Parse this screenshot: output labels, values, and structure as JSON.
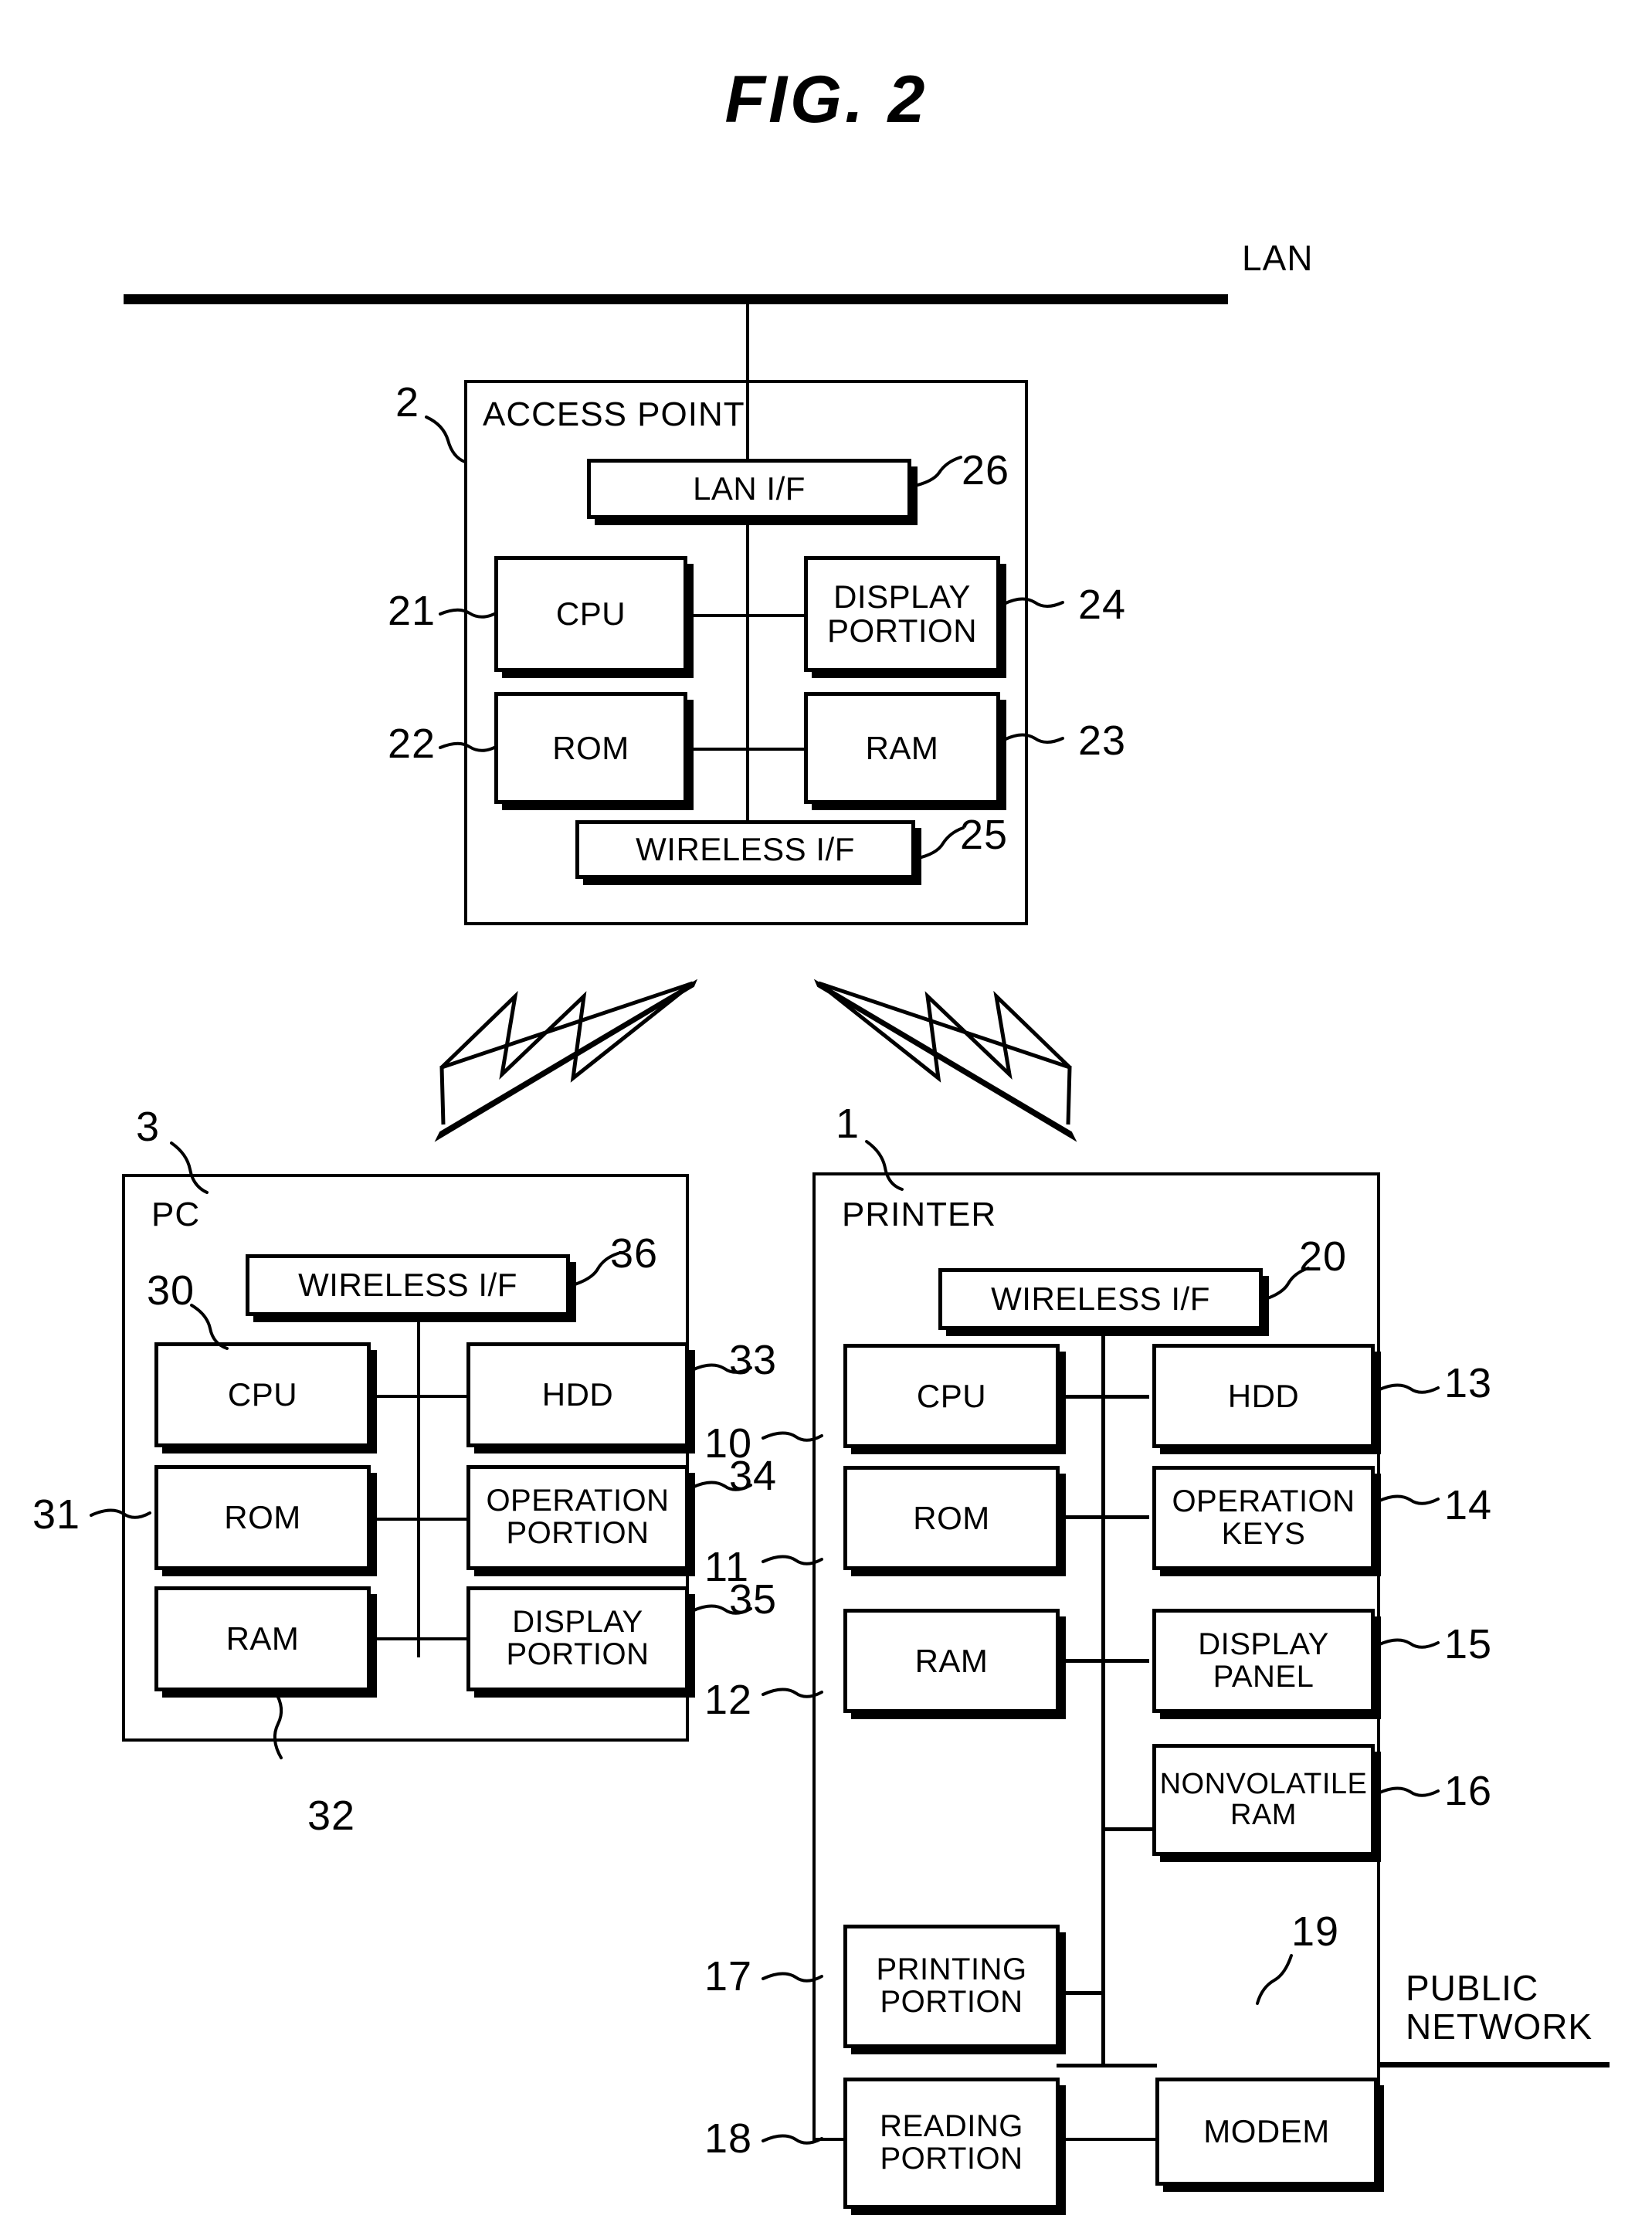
{
  "figure": {
    "title": "FIG.  2"
  },
  "network": {
    "lan_label": "LAN",
    "public_network_label": "PUBLIC\nNETWORK",
    "public_network_line1": "PUBLIC",
    "public_network_line2": "NETWORK"
  },
  "access_point": {
    "title": "ACCESS POINT",
    "ref": "2",
    "blocks": [
      {
        "label": "LAN I/F",
        "ref": "26"
      },
      {
        "label": "CPU",
        "ref": "21"
      },
      {
        "label": "DISPLAY\nPORTION",
        "ref": "24",
        "line1": "DISPLAY",
        "line2": "PORTION"
      },
      {
        "label": "ROM",
        "ref": "22"
      },
      {
        "label": "RAM",
        "ref": "23"
      },
      {
        "label": "WIRELESS I/F",
        "ref": "25"
      }
    ]
  },
  "pc": {
    "title": "PC",
    "ref": "3",
    "blocks": [
      {
        "label": "WIRELESS I/F",
        "ref": "36"
      },
      {
        "label": "CPU",
        "ref": "30"
      },
      {
        "label": "HDD",
        "ref": "33"
      },
      {
        "label": "ROM",
        "ref": "31"
      },
      {
        "label": "OPERATION\nPORTION",
        "ref": "34",
        "line1": "OPERATION",
        "line2": "PORTION"
      },
      {
        "label": "RAM",
        "ref": "32"
      },
      {
        "label": "DISPLAY\nPORTION",
        "ref": "35",
        "line1": "DISPLAY",
        "line2": "PORTION"
      }
    ]
  },
  "printer": {
    "title": "PRINTER",
    "ref": "1",
    "blocks": [
      {
        "label": "WIRELESS I/F",
        "ref": "20"
      },
      {
        "label": "CPU",
        "ref": "10"
      },
      {
        "label": "HDD",
        "ref": "13"
      },
      {
        "label": "ROM",
        "ref": "11"
      },
      {
        "label": "OPERATION\nKEYS",
        "ref": "14",
        "line1": "OPERATION",
        "line2": "KEYS"
      },
      {
        "label": "RAM",
        "ref": "12"
      },
      {
        "label": "DISPLAY\nPANEL",
        "ref": "15",
        "line1": "DISPLAY",
        "line2": "PANEL"
      },
      {
        "label": "NONVOLATILE\nRAM",
        "ref": "16",
        "line1": "NONVOLATILE",
        "line2": "RAM"
      },
      {
        "label": "PRINTING\nPORTION",
        "ref": "17",
        "line1": "PRINTING",
        "line2": "PORTION"
      },
      {
        "label": "READING\nPORTION",
        "ref": "18",
        "line1": "READING",
        "line2": "PORTION"
      },
      {
        "label": "MODEM",
        "ref": "19"
      }
    ]
  },
  "wireless_links": [
    {
      "name": "access-point-to-pc"
    },
    {
      "name": "access-point-to-printer"
    }
  ]
}
